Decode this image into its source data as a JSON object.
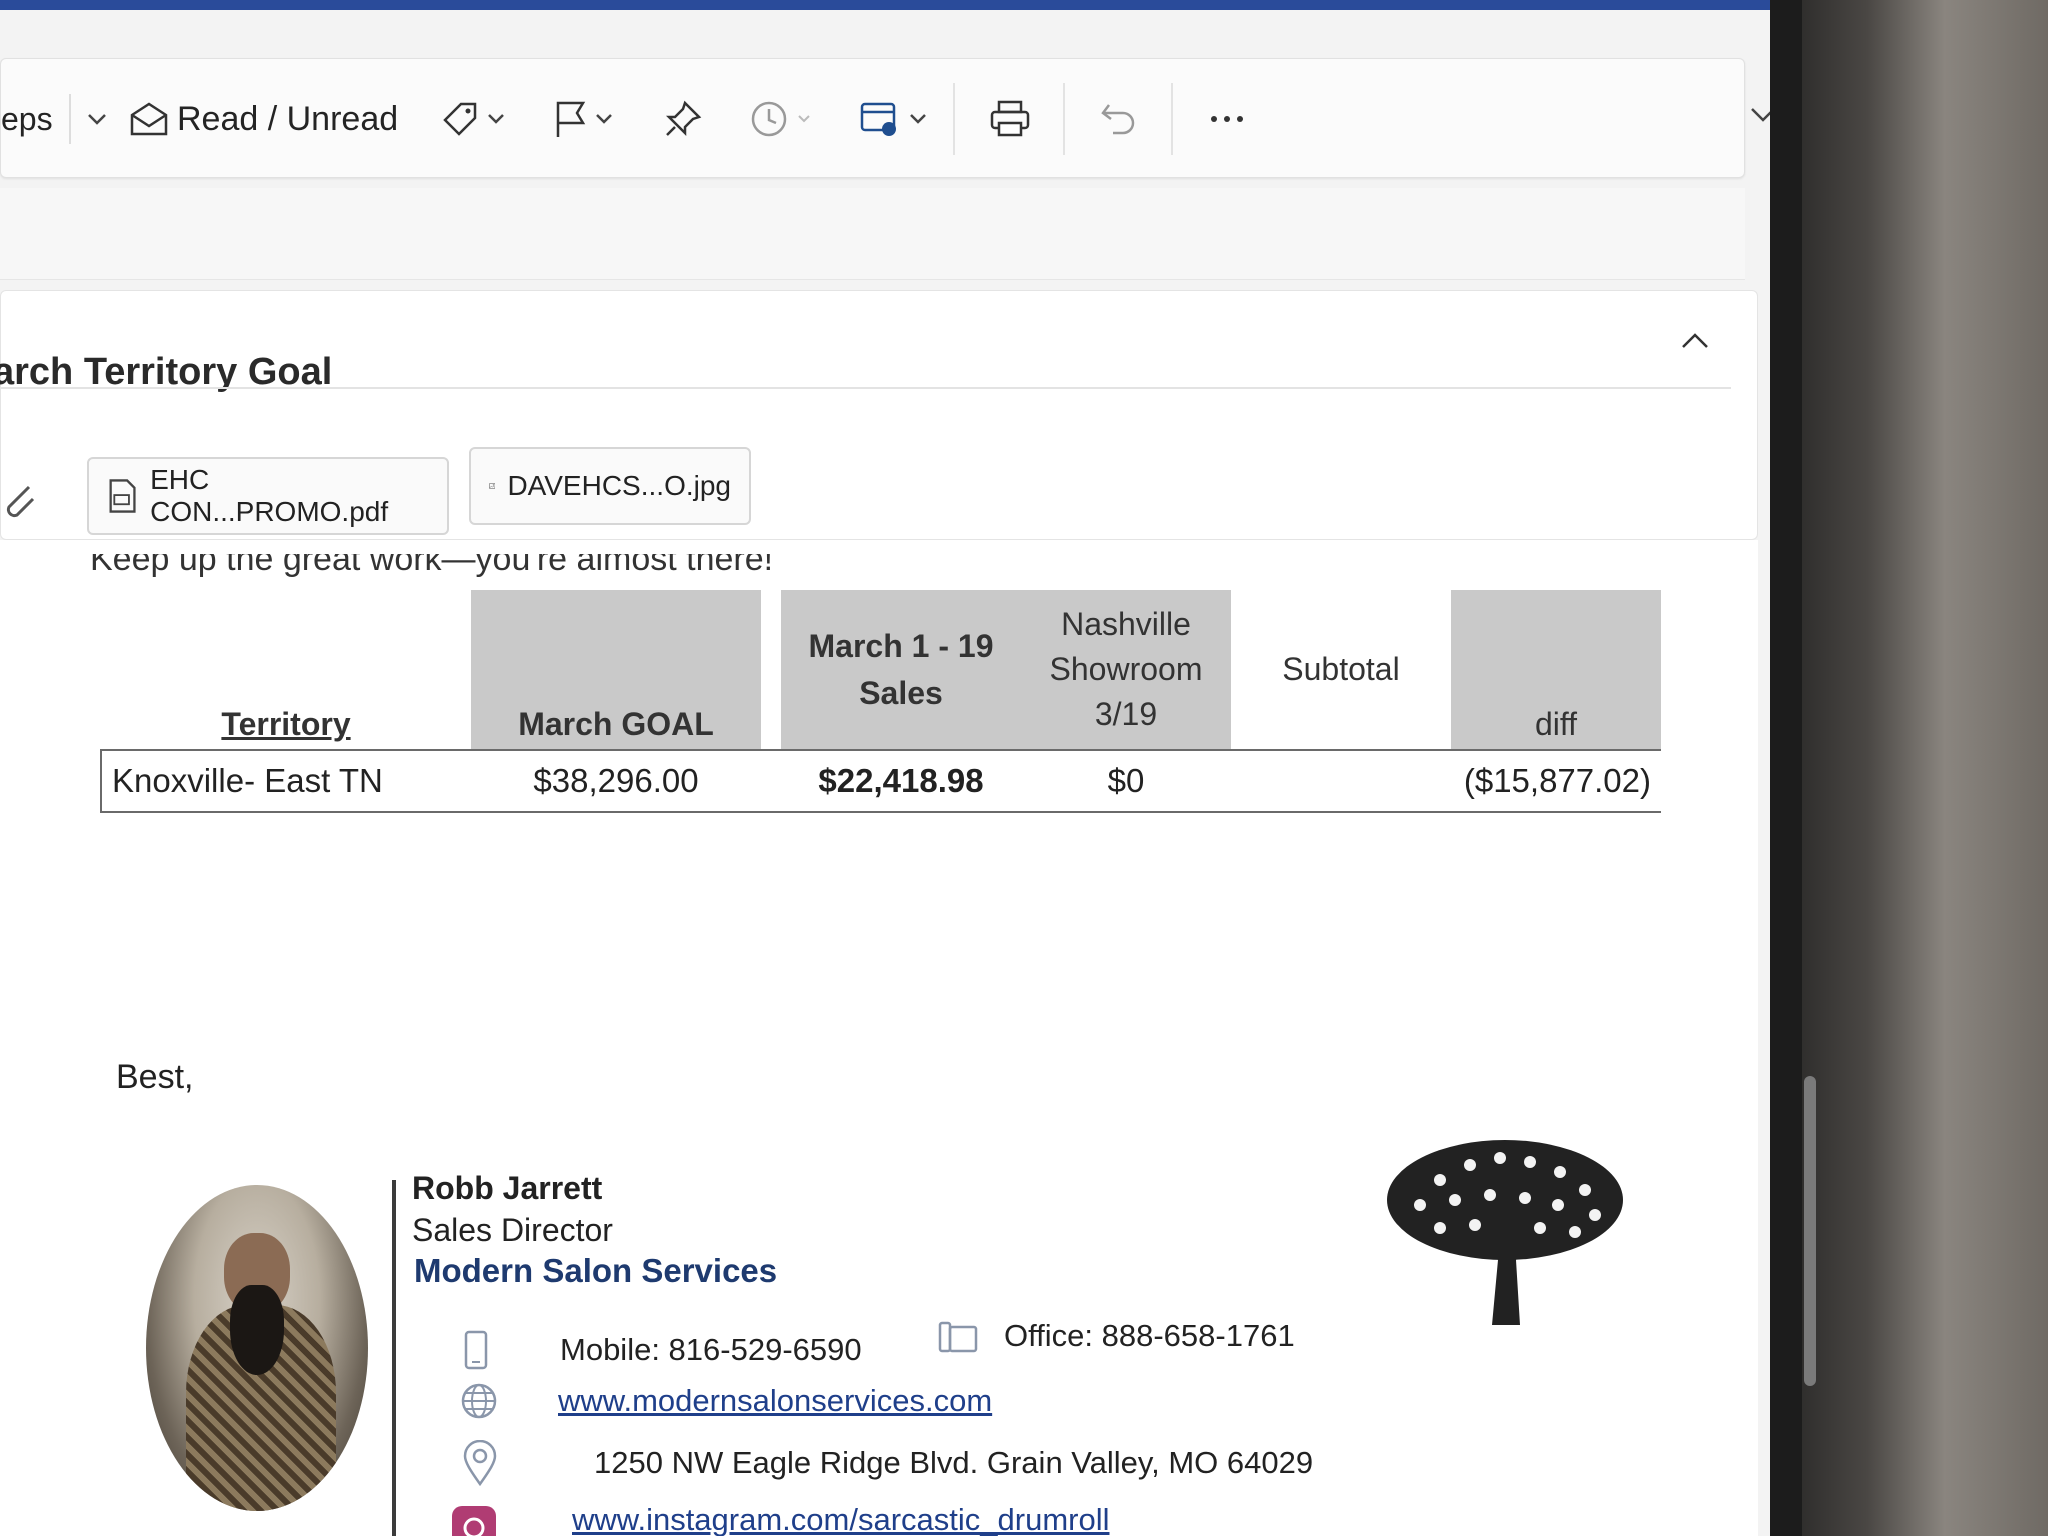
{
  "ribbon": {
    "rules_label": "eps",
    "read_unread_label": "Read / Unread"
  },
  "message": {
    "subject": "arch Territory Goal",
    "attachments": [
      {
        "name": "EHC CON...PROMO.pdf",
        "icon": "pdf-file-icon"
      },
      {
        "name": "DAVEHCS...O.jpg",
        "icon": "image-file-icon"
      }
    ],
    "intro": "Keep up the great work—you're almost there!"
  },
  "table": {
    "headers": {
      "territory": "Territory",
      "march_goal": "March GOAL",
      "march_sales_line1": "March 1 - 19",
      "march_sales_line2": "Sales",
      "nashville_line1": "Nashville",
      "nashville_line2": "Showroom",
      "nashville_line3": "3/19",
      "subtotal": "Subtotal",
      "diff": "diff"
    },
    "row": {
      "territory": "Knoxville- East TN",
      "march_goal": "$38,296.00",
      "march_sales": "$22,418.98",
      "nashville": "$0",
      "subtotal": "",
      "diff": "($15,877.02)"
    }
  },
  "closing": "Best,",
  "signature": {
    "name": "Robb Jarrett",
    "title": "Sales Director",
    "company": "Modern Salon Services",
    "mobile": "Mobile: 816-529-6590",
    "office": "Office: 888-658-1761",
    "website": "www.modernsalonservices.com",
    "address": "1250 NW Eagle Ridge Blvd. Grain Valley, MO 64029",
    "instagram": "www.instagram.com/sarcastic_drumroll"
  },
  "colors": {
    "accent_blue": "#1e3a6f",
    "link_blue": "#1f3f8a",
    "header_shade": "#c9c9c9"
  }
}
